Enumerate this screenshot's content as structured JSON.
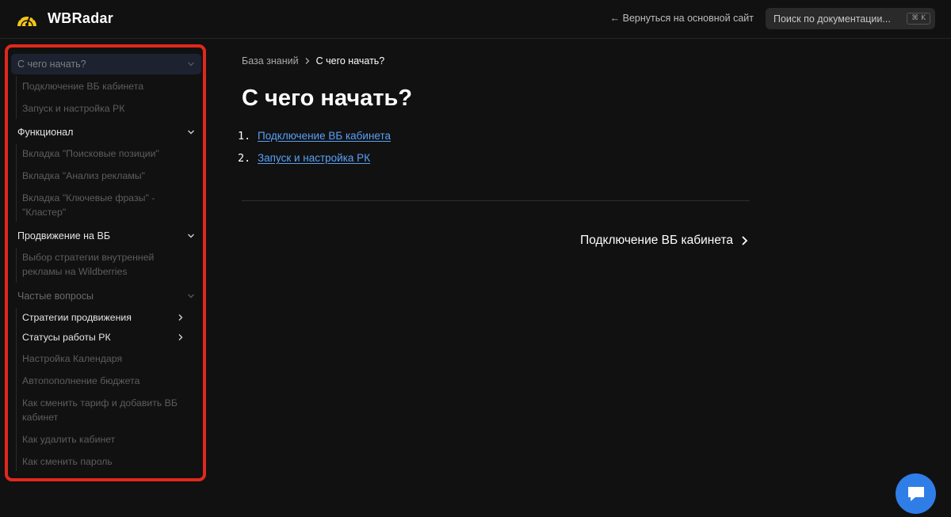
{
  "header": {
    "logo_icon": "speedometer-logo-icon",
    "brand": "WBRadar",
    "back_link": "← Вернуться на основной сайт",
    "search": {
      "placeholder": "Поиск по документации...",
      "shortcut": "⌘ K"
    }
  },
  "sidebar": {
    "sections": [
      {
        "title": "С чего начать?",
        "active": true,
        "items": [
          "Подключение ВБ кабинета",
          "Запуск и настройка РК"
        ]
      },
      {
        "title": "Функционал",
        "items": [
          "Вкладка \"Поисковые позиции\"",
          "Вкладка \"Анализ рекламы\"",
          "Вкладка \"Ключевые фразы\" - \"Кластер\""
        ]
      },
      {
        "title": "Продвижение на ВБ",
        "items": [
          "Выбор стратегии внутренней рекламы на Wildberries"
        ]
      },
      {
        "title": "Частые вопросы",
        "items": [
          "Стратегии продвижения",
          "Статусы работы РК",
          "Настройка Календаря",
          "Автопополнение бюджета",
          "Как сменить тариф и добавить ВБ кабинет",
          "Как удалить кабинет",
          "Как сменить пароль"
        ]
      }
    ]
  },
  "main": {
    "breadcrumb": [
      "База знаний",
      "С чего начать?"
    ],
    "title": "С чего начать?",
    "toc": [
      {
        "num": "1.",
        "label": "Подключение ВБ кабинета"
      },
      {
        "num": "2.",
        "label": "Запуск и настройка РК"
      }
    ],
    "next_link": "Подключение ВБ кабинета"
  },
  "colors": {
    "background": "#111111",
    "link": "#5aa0f5",
    "highlight_border": "#e0281c",
    "chat_button": "#2f7ee8",
    "logo": "#f5c518"
  },
  "chat": {
    "icon": "chat-bubble-icon"
  }
}
